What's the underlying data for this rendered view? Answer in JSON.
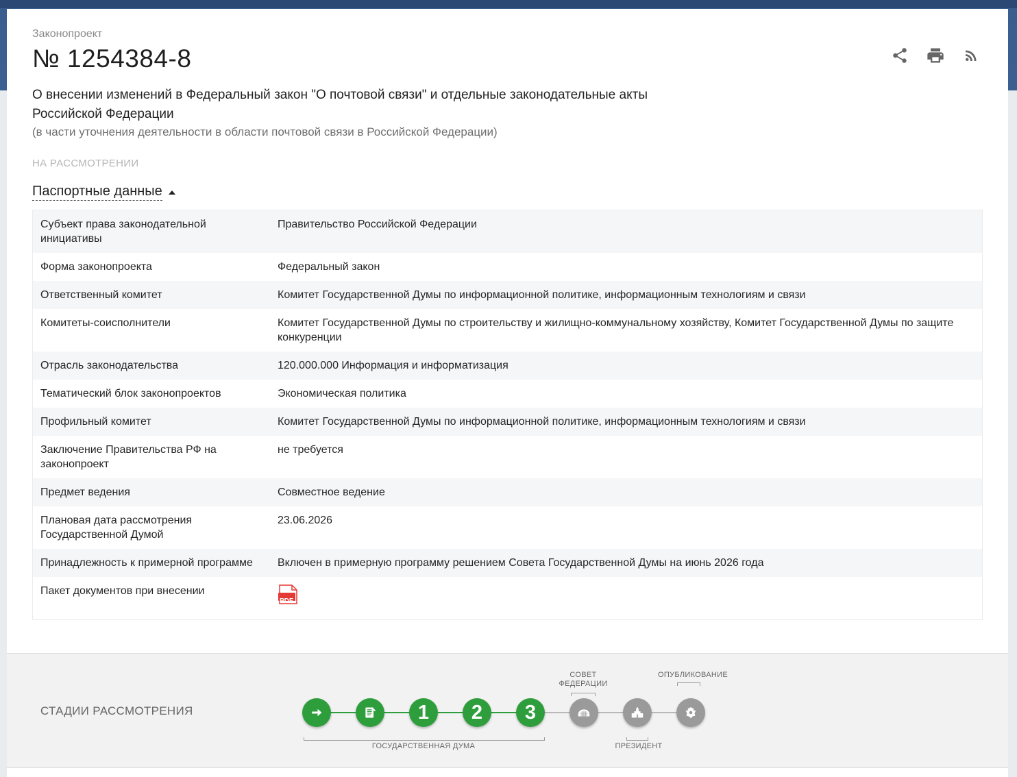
{
  "header": {
    "kind": "Законопроект",
    "number": "№ 1254384-8",
    "title": "О внесении изменений в Федеральный закон \"О почтовой связи\" и отдельные законодательные акты Российской Федерации",
    "subtitle": "(в части уточнения деятельности в области почтовой связи в Российской Федерации)",
    "status": "НА РАССМОТРЕНИИ",
    "actions": [
      {
        "icon": "share-icon"
      },
      {
        "icon": "print-icon"
      },
      {
        "icon": "rss-icon"
      }
    ]
  },
  "passport": {
    "toggle_label": "Паспортные данные",
    "rows": [
      {
        "key": "Субъект права законодательной инициативы",
        "value": "Правительство Российской Федерации"
      },
      {
        "key": "Форма законопроекта",
        "value": "Федеральный закон"
      },
      {
        "key": "Ответственный комитет",
        "value": "Комитет Государственной Думы по информационной политике, информационным технологиям и связи"
      },
      {
        "key": "Комитеты-соисполнители",
        "value": "Комитет Государственной Думы по строительству и жилищно-коммунальному хозяйству, Комитет Государственной Думы по защите конкуренции"
      },
      {
        "key": "Отрасль законодательства",
        "value": "120.000.000 Информация и информатизация"
      },
      {
        "key": "Тематический блок законопроектов",
        "value": "Экономическая политика"
      },
      {
        "key": "Профильный комитет",
        "value": "Комитет Государственной Думы по информационной политике, информационным технологиям и связи"
      },
      {
        "key": "Заключение Правительства РФ на законопроект",
        "value": "не требуется"
      },
      {
        "key": "Предмет ведения",
        "value": "Совместное ведение"
      },
      {
        "key": "Плановая дата рассмотрения Государственной Думой",
        "value": "23.06.2026"
      },
      {
        "key": "Принадлежность к примерной программе",
        "value": "Включен в примерную программу решением Совета Государственной Думы на июнь 2026 года"
      },
      {
        "key": "Пакет документов при внесении",
        "value": "",
        "file_icon": "pdf-icon",
        "file_label": "PDF"
      }
    ]
  },
  "stages": {
    "title": "СТАДИИ РАССМОТРЕНИЯ",
    "items": [
      {
        "name": "stage-introduction",
        "icon": "arrow-right-icon",
        "label": "",
        "state": "done"
      },
      {
        "name": "stage-preliminary",
        "icon": "document-icon",
        "label": "",
        "state": "done"
      },
      {
        "name": "stage-first-reading",
        "icon": "",
        "label": "1",
        "state": "done"
      },
      {
        "name": "stage-second-reading",
        "icon": "",
        "label": "2",
        "state": "done"
      },
      {
        "name": "stage-third-reading",
        "icon": "",
        "label": "3",
        "state": "done"
      },
      {
        "name": "stage-federation-council",
        "icon": "council-chamber-icon",
        "label": "",
        "state": "pending"
      },
      {
        "name": "stage-president",
        "icon": "kremlin-icon",
        "label": "",
        "state": "pending"
      },
      {
        "name": "stage-publication",
        "icon": "coat-of-arms-icon",
        "label": "",
        "state": "pending"
      }
    ],
    "captions": {
      "duma": "ГОСУДАРСТВЕННАЯ ДУМА",
      "council": "СОВЕТ ФЕДЕРАЦИИ",
      "president": "ПРЕЗИДЕНТ",
      "publication": "ОПУБЛИКОВАНИЕ"
    }
  },
  "colors": {
    "header_band": "#3c5f92",
    "stage_done": "#2e9e3d",
    "stage_pending": "#9a9a9a",
    "pdf_red": "#e53935"
  }
}
